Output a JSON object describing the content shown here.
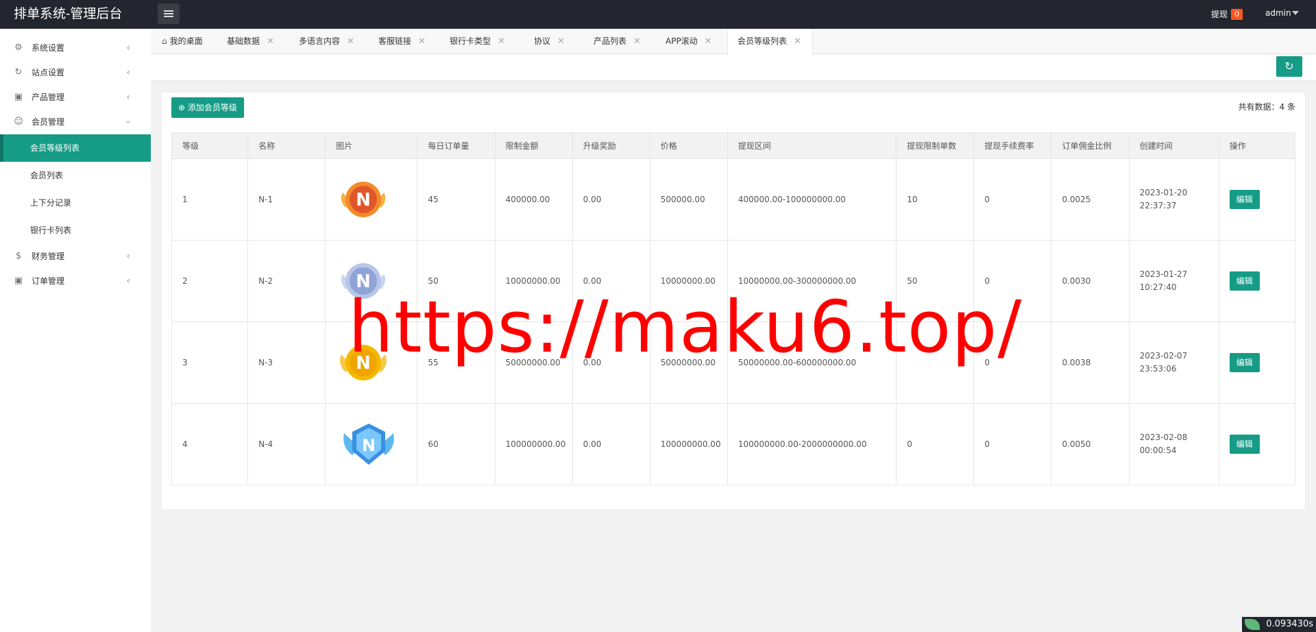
{
  "app": {
    "title": "排单系统-管理后台"
  },
  "topbar": {
    "withdraw_label": "提现",
    "withdraw_count": "0",
    "user": "admin"
  },
  "sidebar": {
    "items": [
      {
        "label": "系统设置",
        "icon": "gear-icon"
      },
      {
        "label": "站点设置",
        "icon": "refresh-icon"
      },
      {
        "label": "产品管理",
        "icon": "box-icon"
      },
      {
        "label": "会员管理",
        "icon": "user-icon"
      },
      {
        "label": "财务管理",
        "icon": "dollar-icon"
      },
      {
        "label": "订单管理",
        "icon": "box-icon"
      }
    ],
    "member_sub": [
      {
        "label": "会员等级列表",
        "active": true
      },
      {
        "label": "会员列表"
      },
      {
        "label": "上下分记录"
      },
      {
        "label": "银行卡列表"
      }
    ]
  },
  "tabs": [
    "我的桌面",
    "基础数据",
    "多语言内容",
    "客服链接",
    "银行卡类型",
    "协议",
    "产品列表",
    "APP滚动",
    "会员等级列表"
  ],
  "main": {
    "add_button": "添加会员等级",
    "total_text": "共有数据：4 条"
  },
  "table": {
    "headers": [
      "等级",
      "名称",
      "图片",
      "每日订单量",
      "限制金额",
      "升级奖励",
      "价格",
      "提现区间",
      "提现限制单数",
      "提现手续费率",
      "订单佣金比例",
      "创建时间",
      "操作"
    ],
    "rows": [
      {
        "level": "1",
        "name": "N-1",
        "badge": "orange",
        "daily": "45",
        "limit": "400000.00",
        "reward": "0.00",
        "price": "500000.00",
        "range": "400000.00-100000000.00",
        "wd_count": "10",
        "fee": "0",
        "commission": "0.0025",
        "created": "2023-01-20 22:37:37",
        "action": "编辑"
      },
      {
        "level": "2",
        "name": "N-2",
        "badge": "silver",
        "daily": "50",
        "limit": "10000000.00",
        "reward": "0.00",
        "price": "10000000.00",
        "range": "10000000.00-300000000.00",
        "wd_count": "50",
        "fee": "0",
        "commission": "0.0030",
        "created": "2023-01-27 10:27:40",
        "action": "编辑"
      },
      {
        "level": "3",
        "name": "N-3",
        "badge": "gold",
        "daily": "55",
        "limit": "50000000.00",
        "reward": "0.00",
        "price": "50000000.00",
        "range": "50000000.00-600000000.00",
        "wd_count": "",
        "fee": "0",
        "commission": "0.0038",
        "created": "2023-02-07 23:53:06",
        "action": "编辑"
      },
      {
        "level": "4",
        "name": "N-4",
        "badge": "blue",
        "daily": "60",
        "limit": "100000000.00",
        "reward": "0.00",
        "price": "100000000.00",
        "range": "100000000.00-2000000000.00",
        "wd_count": "0",
        "fee": "0",
        "commission": "0.0050",
        "created": "2023-02-08 00:00:54",
        "action": "编辑"
      }
    ]
  },
  "watermark": "https://maku6.top/",
  "timer": "0.093430s",
  "colors": {
    "accent": "#169b86",
    "topbar": "#23262e",
    "badge": "#ff5722",
    "watermark": "#ff0000"
  }
}
